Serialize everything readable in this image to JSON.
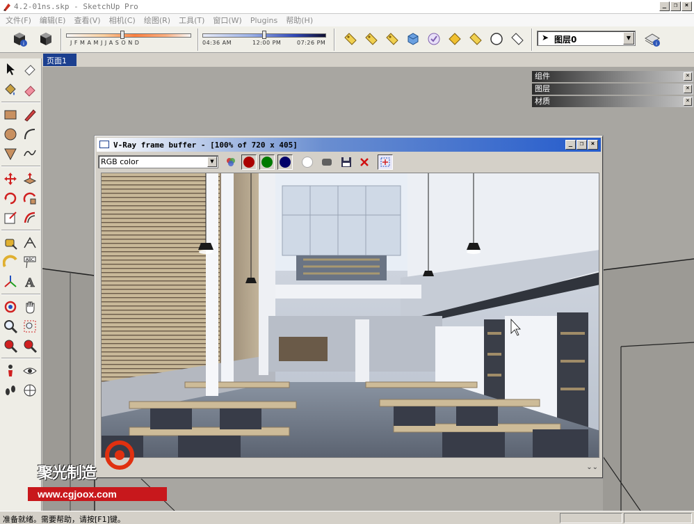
{
  "window": {
    "title": "4.2-01ns.skp - SketchUp Pro",
    "controls": [
      "_",
      "❐",
      "×"
    ]
  },
  "menu": [
    "文件(F)",
    "编辑(E)",
    "查看(V)",
    "相机(C)",
    "绘图(R)",
    "工具(T)",
    "窗口(W)",
    "Plugins",
    "帮助(H)"
  ],
  "shadows": {
    "months_label": "J F M A M J J A S O N D",
    "time_start": "04:36 AM",
    "time_mid": "12:00 PM",
    "time_end": "07:26 PM",
    "month_position": 0.45,
    "time_position": 0.5
  },
  "layer_select": {
    "value": "图层0"
  },
  "page_tab": {
    "label": "页面1"
  },
  "tray": {
    "panels": [
      "组件",
      "图层",
      "材质"
    ]
  },
  "vfb": {
    "title": "V-Ray frame buffer - [100% of 720 x 405]",
    "channel": "RGB color",
    "channel_colors": {
      "red": "#aa0000",
      "green": "#007a00",
      "blue": "#00006a"
    }
  },
  "watermark": {
    "brand": "聚光制造",
    "url": "www.cgjoox.com"
  },
  "status": {
    "message": "准备就绪。需要帮助，请按[F1]键。"
  },
  "colors": {
    "page_tab": "#1b3f8f",
    "viewport": "#a8a6a1"
  }
}
